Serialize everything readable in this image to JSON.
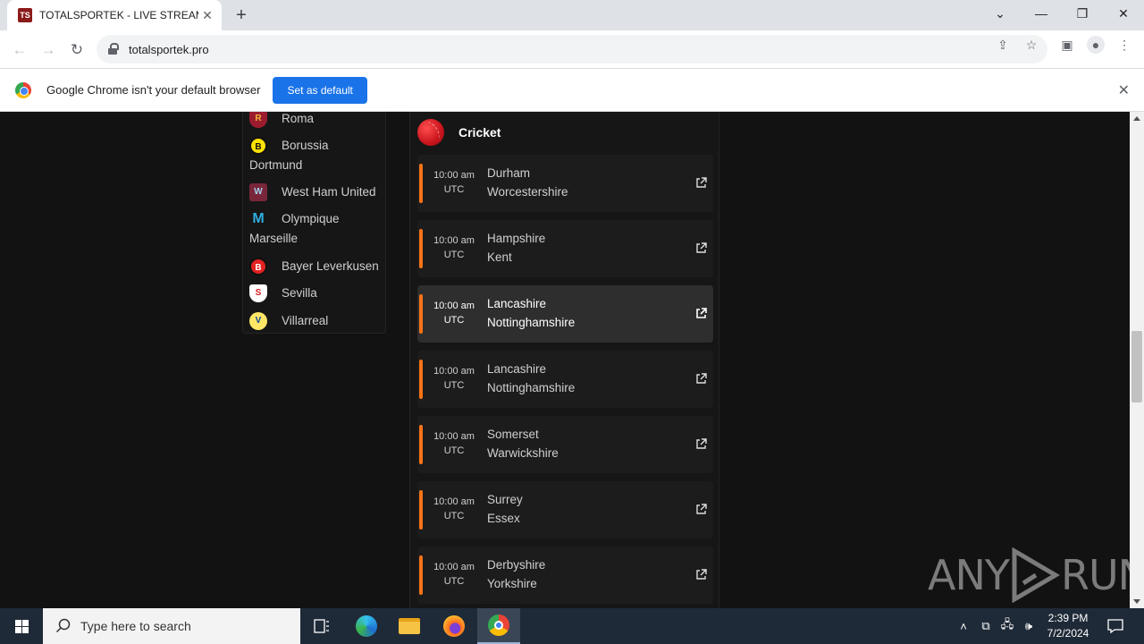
{
  "browser": {
    "tab_title": "TOTALSPORTEK - LIVE STREAMS",
    "favicon_text": "TS",
    "url": "totalsportek.pro"
  },
  "infobar": {
    "message": "Google Chrome isn't your default browser",
    "button_label": "Set as default"
  },
  "sidebar": {
    "teams": [
      {
        "name": "Roma",
        "icon": "roma-crest-icon",
        "color": "#9b1c2e"
      },
      {
        "name": "Borussia Dortmund",
        "icon": "dortmund-crest-icon",
        "color": "#fde100"
      },
      {
        "name": "West Ham United",
        "icon": "west-ham-crest-icon",
        "color": "#7a263a"
      },
      {
        "name": "Olympique Marseille",
        "icon": "marseille-crest-icon",
        "color": "#2faee0"
      },
      {
        "name": "Bayer Leverkusen",
        "icon": "leverkusen-crest-icon",
        "color": "#e32221"
      },
      {
        "name": "Sevilla",
        "icon": "sevilla-crest-icon",
        "color": "#d71920"
      },
      {
        "name": "Villarreal",
        "icon": "villarreal-crest-icon",
        "color": "#ffe667"
      }
    ]
  },
  "cricket": {
    "title": "Cricket",
    "matches": [
      {
        "time": "10:00 am",
        "zone": "UTC",
        "home": "Durham",
        "away": "Worcestershire"
      },
      {
        "time": "10:00 am",
        "zone": "UTC",
        "home": "Hampshire",
        "away": "Kent"
      },
      {
        "time": "10:00 am",
        "zone": "UTC",
        "home": "Lancashire",
        "away": "Nottinghamshire"
      },
      {
        "time": "10:00 am",
        "zone": "UTC",
        "home": "Lancashire",
        "away": "Nottinghamshire"
      },
      {
        "time": "10:00 am",
        "zone": "UTC",
        "home": "Somerset",
        "away": "Warwickshire"
      },
      {
        "time": "10:00 am",
        "zone": "UTC",
        "home": "Surrey",
        "away": "Essex"
      },
      {
        "time": "10:00 am",
        "zone": "UTC",
        "home": "Derbyshire",
        "away": "Yorkshire"
      }
    ]
  },
  "watermark": {
    "left": "ANY",
    "right": "RUN"
  },
  "taskbar": {
    "search_placeholder": "Type here to search",
    "time": "2:39 PM",
    "date": "7/2/2024"
  },
  "colors": {
    "accent": "#f97316",
    "link_blue": "#1a73e8"
  }
}
